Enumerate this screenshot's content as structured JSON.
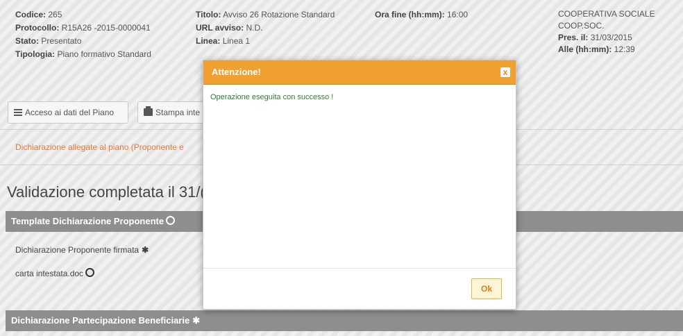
{
  "info": {
    "codice_label": "Codice:",
    "codice_value": "265",
    "protocollo_label": "Protocollo:",
    "protocollo_value": "R15A26 -2015-0000041",
    "stato_label": "Stato:",
    "stato_value": "Presentato",
    "tipologia_label": "Tipologia:",
    "tipologia_value": "Piano formativo Standard",
    "titolo_label": "Titolo:",
    "titolo_value": "Avviso 26 Rotazione Standard",
    "url_label": "URL avviso:",
    "url_value": "N.D.",
    "linea_label": "Linea:",
    "linea_value": "Linea 1",
    "ora_fine_label": "Ora fine (hh:mm):",
    "ora_fine_value": "16:00",
    "org_line1": "COOPERATIVA SOCIALE",
    "org_line2": "COOP.SOC.",
    "pres_label": "Pres. il:",
    "pres_value": "31/03/2015",
    "alle_label": "Alle (hh:mm):",
    "alle_value": "12:39"
  },
  "toolbar": {
    "access_label": "Acceso ai dati del Piano",
    "print_label": "Stampa inte"
  },
  "declarations_link": "Dichiarazione allegate al piano (Proponente e",
  "validation_text": "Validazione completata il 31/(",
  "sections": {
    "template_title": "Template Dichiarazione Proponente",
    "firmata_label": "Dichiarazione Proponente firmata",
    "file_name": "carta intestata.doc",
    "partecipazione_title": "Dichiarazione Partecipazione Beneficiarie"
  },
  "modal": {
    "title": "Attenzione!",
    "close_glyph": "x",
    "message": "Operazione eseguita con successo !",
    "ok_label": "Ok"
  },
  "colors": {
    "accent": "#f0a031",
    "success": "#2e7d32",
    "link": "#e07a3c",
    "section": "#8e8e8e"
  }
}
